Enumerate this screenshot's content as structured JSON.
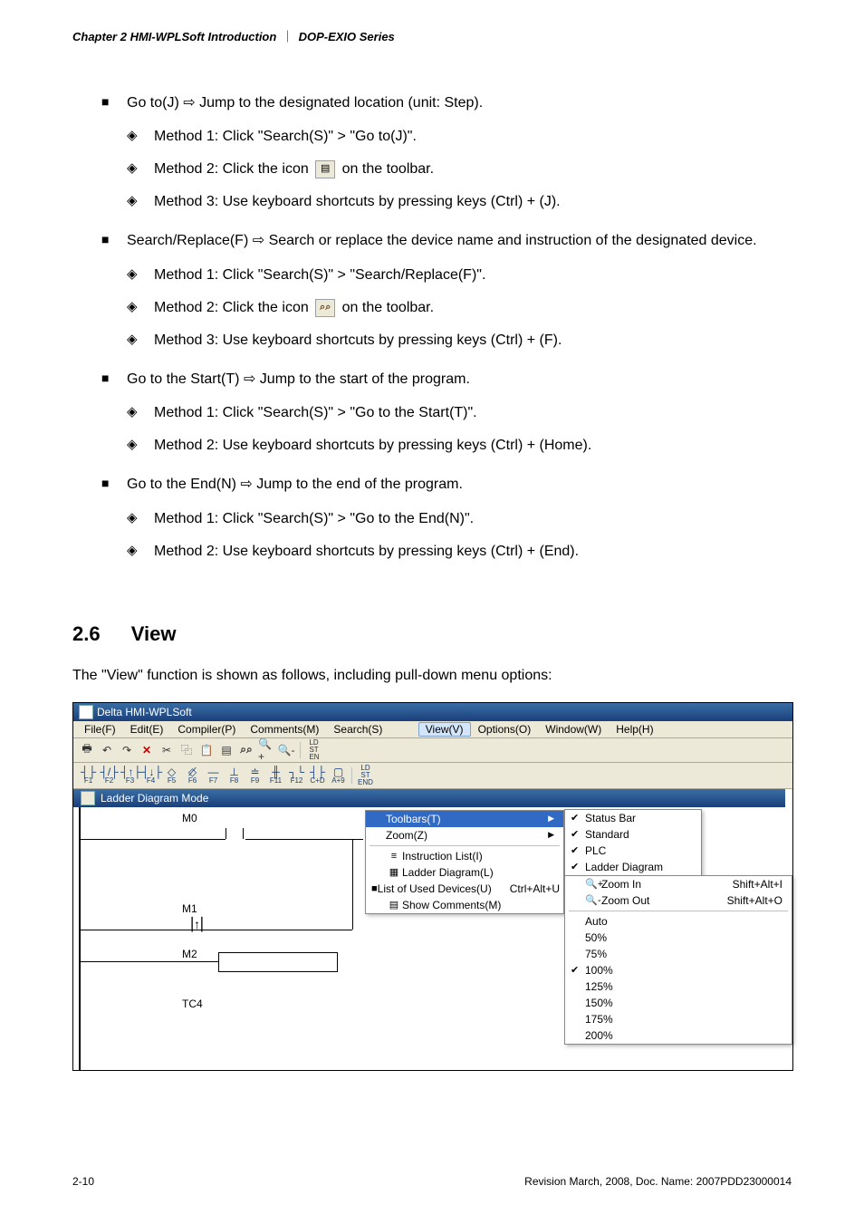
{
  "header": {
    "chapter": "Chapter 2 HMI-WPLSoft Introduction",
    "series": "DOP-EXIO Series"
  },
  "items": [
    {
      "title_prefix": "Go to(J)",
      "title_rest": "Jump to the designated location (unit: Step).",
      "methods": [
        {
          "text": "Method 1: Click \"Search(S)\" > \"Go to(J)\"."
        },
        {
          "text_before": "Method 2: Click the icon",
          "icon": "goto-icon",
          "text_after": "on the toolbar."
        },
        {
          "text": "Method 3: Use keyboard shortcuts by pressing keys (Ctrl) + (J)."
        }
      ]
    },
    {
      "title_prefix": "Search/Replace(F)",
      "title_rest": "Search or replace the device name and instruction of the designated device.",
      "methods": [
        {
          "text": "Method 1: Click \"Search(S)\" > \"Search/Replace(F)\"."
        },
        {
          "text_before": "Method 2: Click the icon",
          "icon": "binoculars-icon",
          "text_after": "on the toolbar."
        },
        {
          "text": "Method 3: Use keyboard shortcuts by pressing keys (Ctrl) + (F)."
        }
      ]
    },
    {
      "title_prefix": "Go to the Start(T)",
      "title_rest": "Jump to the start of the program.",
      "methods": [
        {
          "text": "Method 1: Click \"Search(S)\" > \"Go to the Start(T)\"."
        },
        {
          "text": "Method 2: Use keyboard shortcuts by pressing keys (Ctrl) + (Home)."
        }
      ]
    },
    {
      "title_prefix": "Go to the End(N)",
      "title_rest": "Jump to the end of the program.",
      "methods": [
        {
          "text": "Method 1: Click \"Search(S)\" > \"Go to the End(N)\"."
        },
        {
          "text": "Method 2: Use keyboard shortcuts by pressing keys (Ctrl) + (End)."
        }
      ]
    }
  ],
  "section": {
    "number": "2.6",
    "title": "View",
    "description": "The \"View\" function is shown as follows, including pull-down menu options:"
  },
  "app": {
    "title": "Delta HMI-WPLSoft",
    "menubar": [
      "File(F)",
      "Edit(E)",
      "Compiler(P)",
      "Comments(M)",
      "Search(S)",
      "View(V)",
      "Options(O)",
      "Window(W)",
      "Help(H)"
    ],
    "fn_keys": [
      "F1",
      "F2",
      "F3",
      "F4",
      "F5",
      "F6",
      "F7",
      "F8",
      "F9",
      "F11",
      "F12",
      "C+D",
      "A+9"
    ],
    "ladder_title": "Ladder Diagram Mode",
    "ladder_symbols": [
      "M0",
      "M1",
      "M2",
      "TC4"
    ],
    "view_menu": [
      {
        "label": "Toolbars(T)",
        "submenu": true,
        "highlight": true
      },
      {
        "label": "Zoom(Z)",
        "submenu": true
      },
      "sep",
      {
        "icon": "il",
        "label": "Instruction List(I)"
      },
      {
        "icon": "ld",
        "label": "Ladder Diagram(L)"
      },
      {
        "icon": "ud",
        "label": "List of Used Devices(U)",
        "shortcut": "Ctrl+Alt+U"
      },
      {
        "icon": "sc",
        "label": "Show Comments(M)"
      }
    ],
    "toolbars_submenu": [
      {
        "checked": true,
        "label": "Status Bar"
      },
      {
        "checked": true,
        "label": "Standard"
      },
      {
        "checked": true,
        "label": "PLC"
      },
      {
        "checked": true,
        "label": "Ladder Diagram"
      }
    ],
    "zoom_submenu": [
      {
        "icon": "zin",
        "label": "Zoom In",
        "shortcut": "Shift+Alt+I"
      },
      {
        "icon": "zout",
        "label": "Zoom Out",
        "shortcut": "Shift+Alt+O"
      },
      "sep",
      {
        "label": "Auto"
      },
      {
        "label": "50%"
      },
      {
        "label": "75%"
      },
      {
        "checked": true,
        "label": "100%"
      },
      {
        "label": "125%"
      },
      {
        "label": "150%"
      },
      {
        "label": "175%"
      },
      {
        "label": "200%"
      }
    ]
  },
  "footer": {
    "page": "2-10",
    "rev": "Revision March, 2008, Doc. Name: 2007PDD23000014"
  }
}
